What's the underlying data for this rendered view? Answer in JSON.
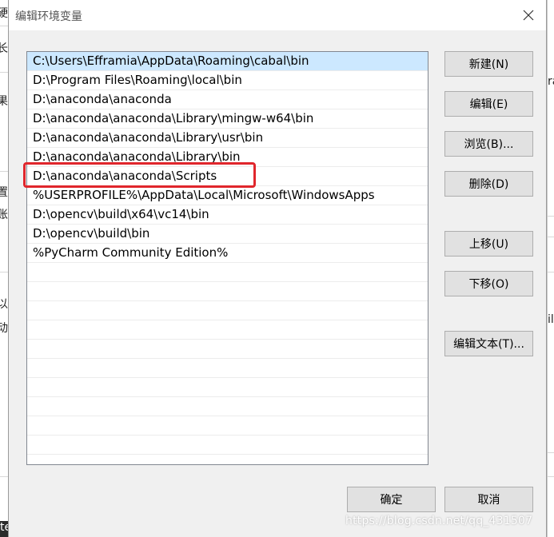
{
  "dialog": {
    "title": "编辑环境变量"
  },
  "env_list": {
    "items": [
      "C:\\Users\\Efframia\\AppData\\Roaming\\cabal\\bin",
      "D:\\Program Files\\Roaming\\local\\bin",
      "D:\\anaconda\\anaconda",
      "D:\\anaconda\\anaconda\\Library\\mingw-w64\\bin",
      "D:\\anaconda\\anaconda\\Library\\usr\\bin",
      "D:\\anaconda\\anaconda\\Library\\bin",
      "D:\\anaconda\\anaconda\\Scripts",
      "%USERPROFILE%\\AppData\\Local\\Microsoft\\WindowsApps",
      "D:\\opencv\\build\\x64\\vc14\\bin",
      "D:\\opencv\\build\\bin",
      "%PyCharm Community Edition%"
    ],
    "selected_index": 0,
    "highlighted_index": 6
  },
  "buttons": {
    "new": "新建(N)",
    "edit": "编辑(E)",
    "browse": "浏览(B)...",
    "delete": "删除(D)",
    "move_up": "上移(U)",
    "move_down": "下移(O)",
    "edit_text": "编辑文本(T)...",
    "ok": "确定",
    "cancel": "取消"
  },
  "background": {
    "left_fragments": [
      "硬",
      "长多",
      "果",
      "置",
      "账",
      "以",
      "动"
    ],
    "right_fragments": [
      "ra",
      "ile"
    ],
    "bottom_fragment": "term"
  },
  "watermark": "https://blog.csdn.net/qq_431507",
  "colors": {
    "selection": "#cce8ff",
    "highlight_box": "#e0262c"
  }
}
